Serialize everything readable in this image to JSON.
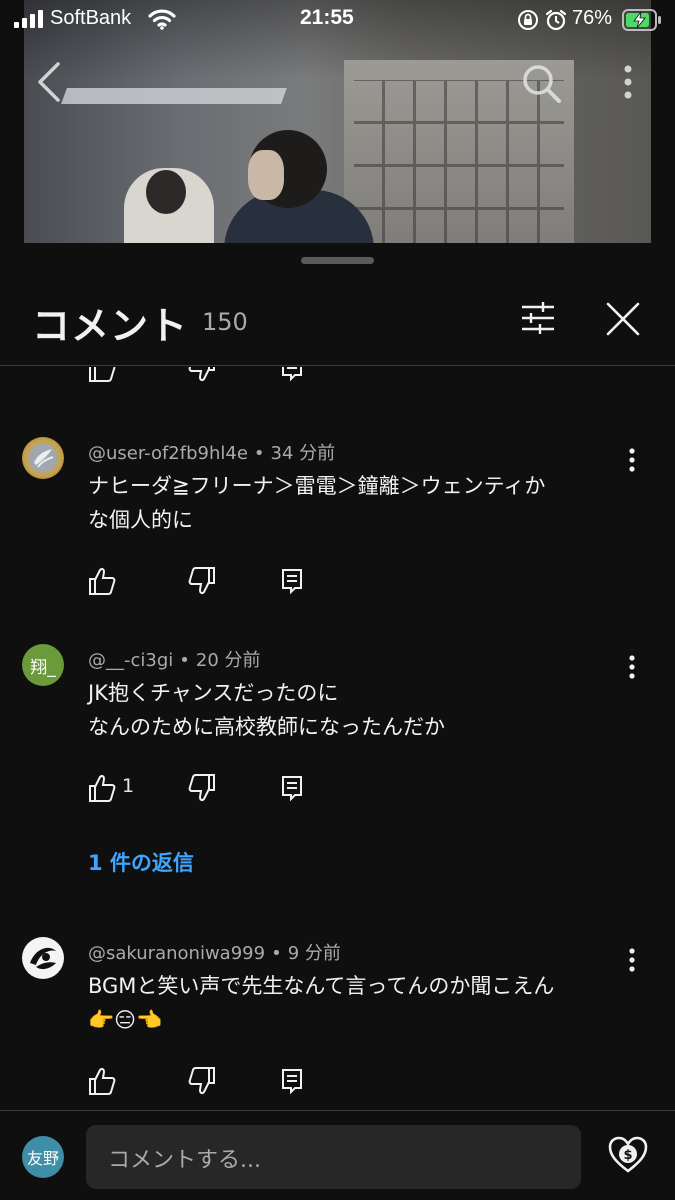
{
  "status_bar": {
    "carrier": "SoftBank",
    "time": "21:55",
    "battery": "76%"
  },
  "video": {
    "icons": [
      "back-icon",
      "search-icon",
      "more-icon"
    ]
  },
  "comments_panel": {
    "title": "コメント",
    "count": "150",
    "comments": [
      {
        "author": "@user-of2fb9hl4e",
        "time": "34 分前",
        "text_lines": [
          "ナヒーダ≧フリーナ＞雷電＞鐘離＞ウェンティか",
          "な個人的に"
        ],
        "likes": ""
      },
      {
        "author": "@__-ci3gi",
        "avatar_text": "翔_",
        "avatar_color": "#6a9a3a",
        "time": "20 分前",
        "text_lines": [
          "JK抱くチャンスだったのに",
          "なんのために高校教師になったんだか"
        ],
        "likes": "1",
        "replies": "1 件の返信"
      },
      {
        "author": "@sakuranoniwa999",
        "time": "9 分前",
        "text_lines": [
          "BGMと笑い声で先生なんて言ってんのか聞こえん",
          "👉😑👈"
        ],
        "likes": ""
      }
    ]
  },
  "composer": {
    "avatar_text": "友野",
    "avatar_color": "#3f8ea8",
    "placeholder": "コメントする..."
  },
  "meta_separator": "•"
}
